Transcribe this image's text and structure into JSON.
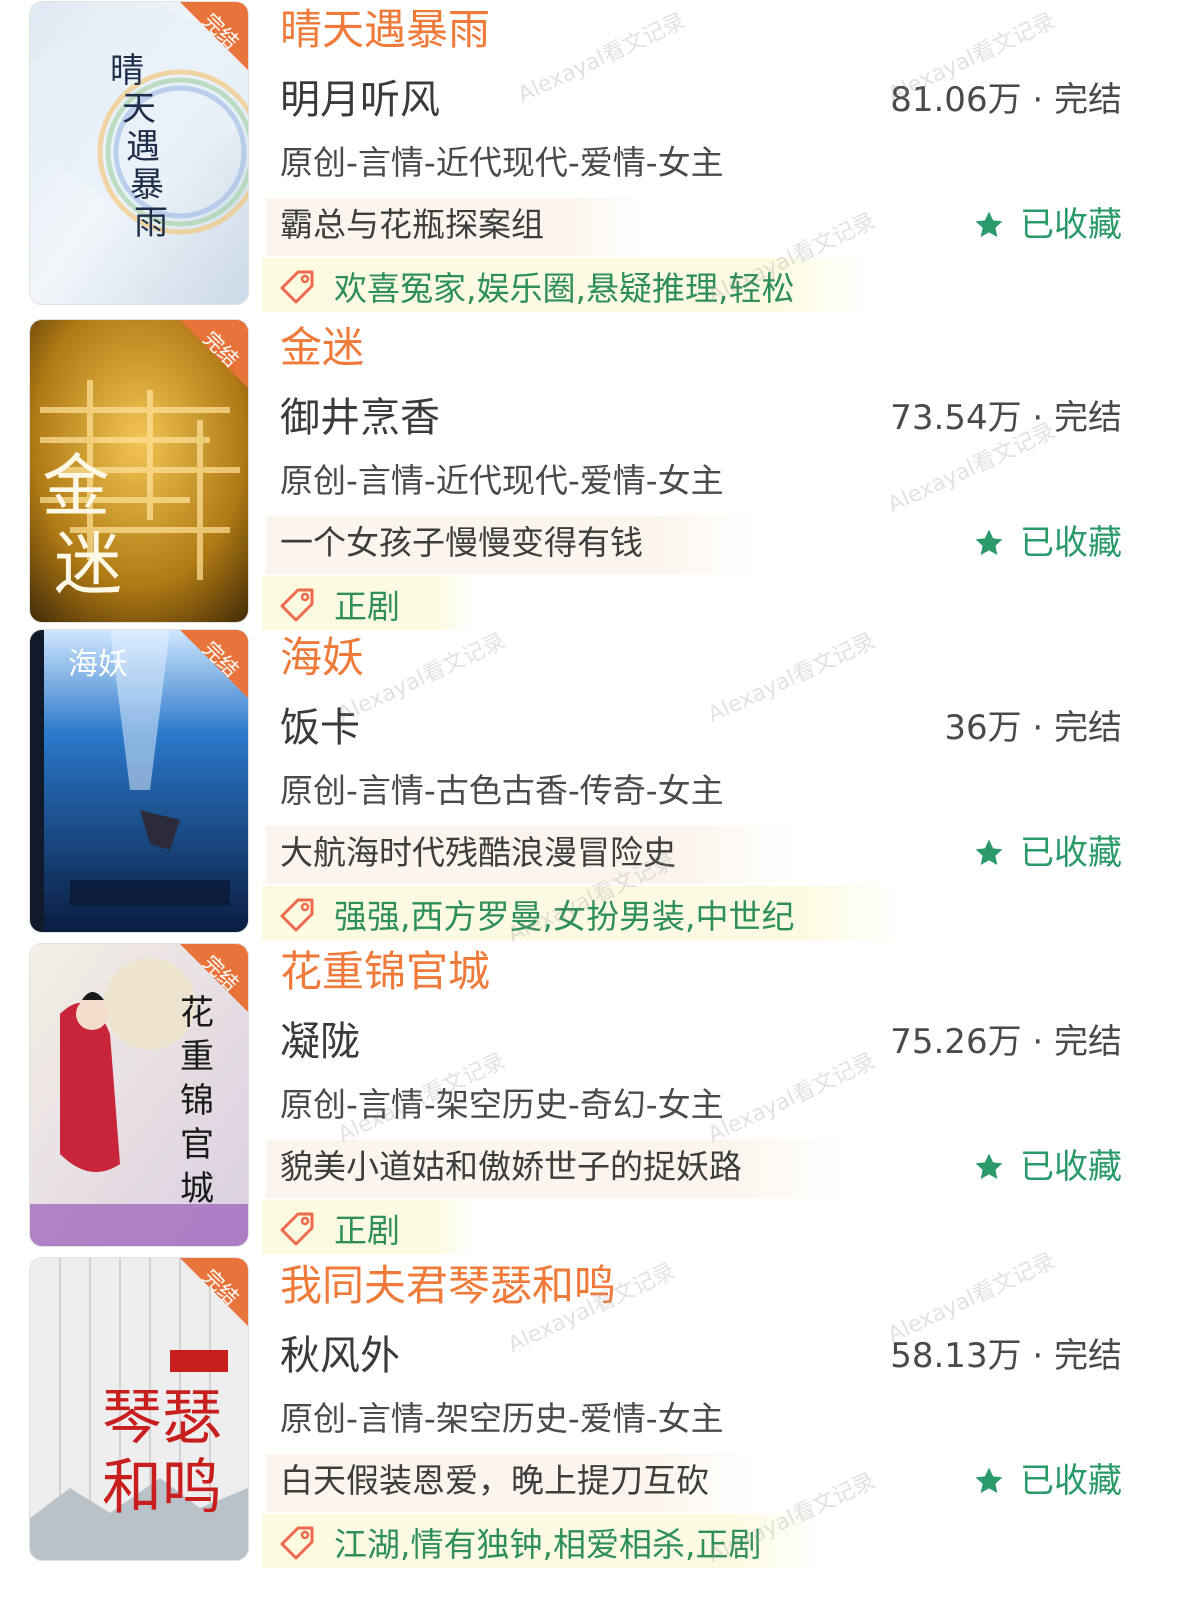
{
  "books": [
    {
      "title": "晴天遇暴雨",
      "author": "明月听风",
      "stats": "81.06万 · 完结",
      "genre": "原创-言情-近代现代-爱情-女主",
      "summary": "霸总与花瓶探案组",
      "favorite": "已收藏",
      "tags": "欢喜冤家,娱乐圈,悬疑推理,轻松",
      "cover_badge": "完结",
      "cover_text": "晴天遇暴雨"
    },
    {
      "title": "金迷",
      "author": "御井烹香",
      "stats": "73.54万 · 完结",
      "genre": "原创-言情-近代现代-爱情-女主",
      "summary": "一个女孩子慢慢变得有钱",
      "favorite": "已收藏",
      "tags": "正剧",
      "cover_badge": "完结",
      "cover_text": "金迷"
    },
    {
      "title": "海妖",
      "author": "饭卡",
      "stats": "36万 · 完结",
      "genre": "原创-言情-古色古香-传奇-女主",
      "summary": "大航海时代残酷浪漫冒险史",
      "favorite": "已收藏",
      "tags": "强强,西方罗曼,女扮男装,中世纪",
      "cover_badge": "完结",
      "cover_text": "海妖"
    },
    {
      "title": "花重锦官城",
      "author": "凝陇",
      "stats": "75.26万 · 完结",
      "genre": "原创-言情-架空历史-奇幻-女主",
      "summary": "貌美小道姑和傲娇世子的捉妖路",
      "favorite": "已收藏",
      "tags": "正剧",
      "cover_badge": "完结",
      "cover_text": "花重锦官城"
    },
    {
      "title": "我同夫君琴瑟和鸣",
      "author": "秋风外",
      "stats": "58.13万 · 完结",
      "genre": "原创-言情-架空历史-爱情-女主",
      "summary": "白天假装恩爱，晚上提刀互砍",
      "favorite": "已收藏",
      "tags": "江湖,情有独钟,相爱相杀,正剧",
      "cover_badge": "完结",
      "cover_text": "琴瑟和鸣"
    }
  ],
  "watermark": "Alexayal看文记录",
  "colors": {
    "title": "#ef7a3a",
    "favorite": "#2a9a6a",
    "tag": "#2f8f5a",
    "badge": "#e8743b"
  },
  "icons": [
    "star-icon",
    "tag-icon"
  ]
}
